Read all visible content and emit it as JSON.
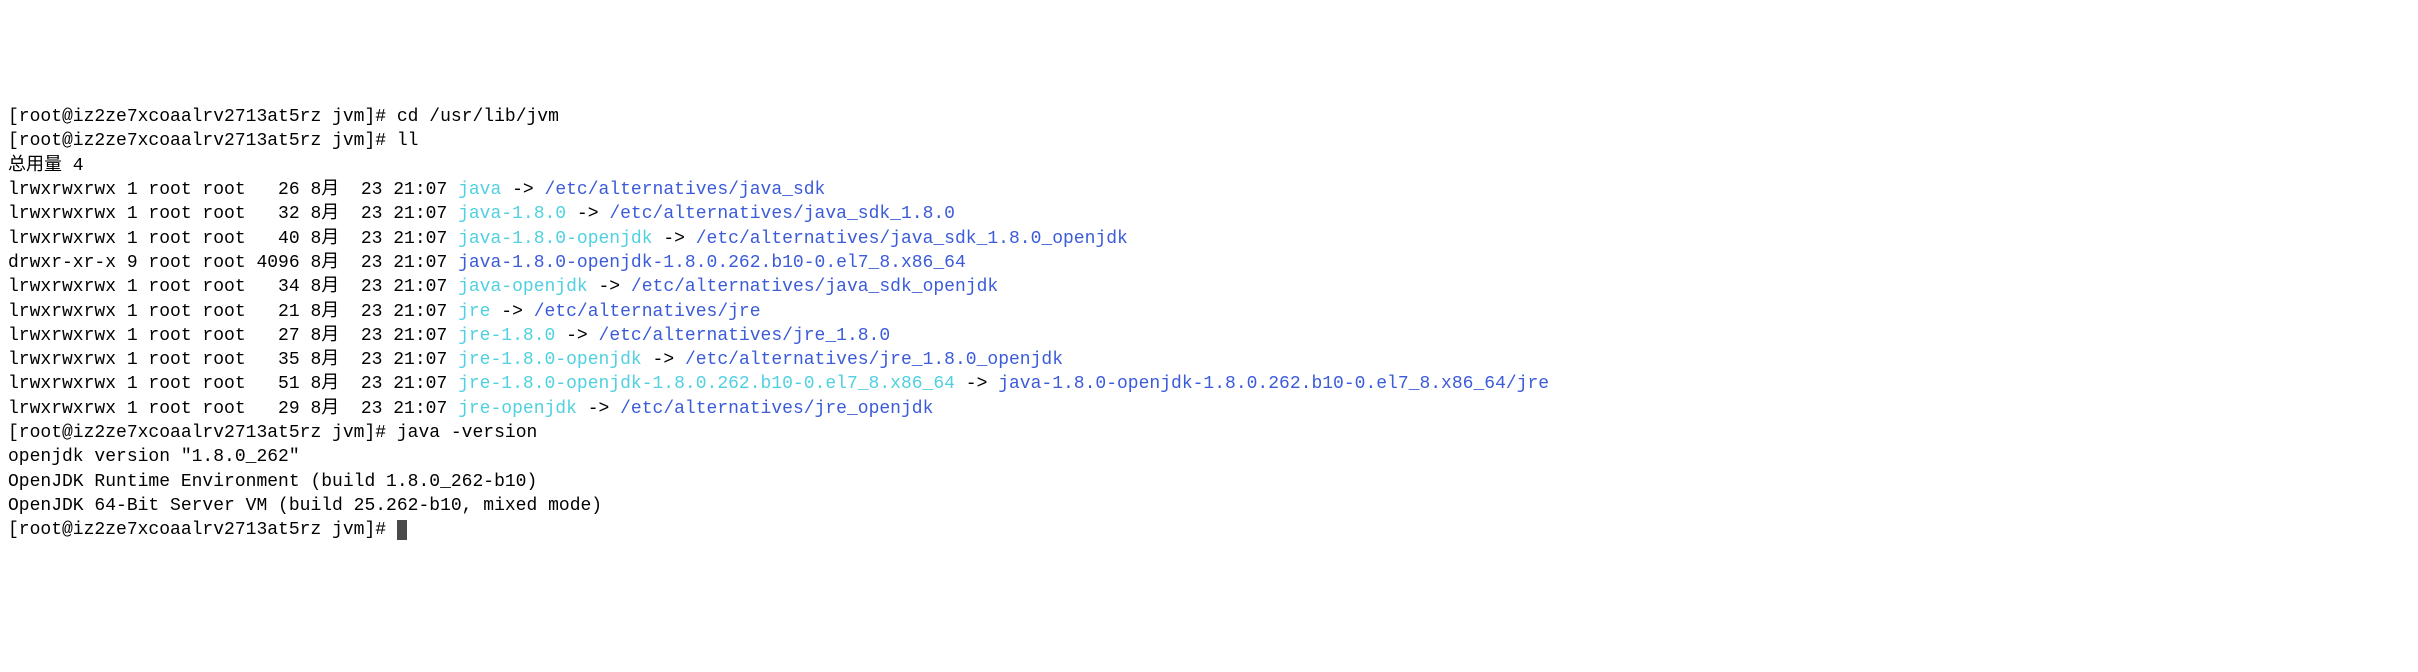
{
  "prompt": "[root@iz2ze7xcoaalrv2713at5rz jvm]# ",
  "cmd_cd": "cd /usr/lib/jvm",
  "cmd_ll": "ll",
  "cmd_java_version": "java -version",
  "total_line": "总用量 4",
  "listings": [
    {
      "perms": "lrwxrwxrwx 1 root root   26 8月  23 21:07 ",
      "name": "java",
      "arrow": " -> ",
      "target": "/etc/alternatives/java_sdk"
    },
    {
      "perms": "lrwxrwxrwx 1 root root   32 8月  23 21:07 ",
      "name": "java-1.8.0",
      "arrow": " -> ",
      "target": "/etc/alternatives/java_sdk_1.8.0"
    },
    {
      "perms": "lrwxrwxrwx 1 root root   40 8月  23 21:07 ",
      "name": "java-1.8.0-openjdk",
      "arrow": " -> ",
      "target": "/etc/alternatives/java_sdk_1.8.0_openjdk"
    },
    {
      "perms": "drwxr-xr-x 9 root root 4096 8月  23 21:07 ",
      "name": "java-1.8.0-openjdk-1.8.0.262.b10-0.el7_8.x86_64",
      "arrow": "",
      "target": "",
      "name_color": "blue"
    },
    {
      "perms": "lrwxrwxrwx 1 root root   34 8月  23 21:07 ",
      "name": "java-openjdk",
      "arrow": " -> ",
      "target": "/etc/alternatives/java_sdk_openjdk"
    },
    {
      "perms": "lrwxrwxrwx 1 root root   21 8月  23 21:07 ",
      "name": "jre",
      "arrow": " -> ",
      "target": "/etc/alternatives/jre"
    },
    {
      "perms": "lrwxrwxrwx 1 root root   27 8月  23 21:07 ",
      "name": "jre-1.8.0",
      "arrow": " -> ",
      "target": "/etc/alternatives/jre_1.8.0"
    },
    {
      "perms": "lrwxrwxrwx 1 root root   35 8月  23 21:07 ",
      "name": "jre-1.8.0-openjdk",
      "arrow": " -> ",
      "target": "/etc/alternatives/jre_1.8.0_openjdk"
    },
    {
      "perms": "lrwxrwxrwx 1 root root   51 8月  23 21:07 ",
      "name": "jre-1.8.0-openjdk-1.8.0.262.b10-0.el7_8.x86_64",
      "arrow": " -> ",
      "target": "java-1.8.0-openjdk-1.8.0.262.b10-0.el7_8.x86_64/jre"
    },
    {
      "perms": "lrwxrwxrwx 1 root root   29 8月  23 21:07 ",
      "name": "jre-openjdk",
      "arrow": " -> ",
      "target": "/etc/alternatives/jre_openjdk"
    }
  ],
  "version_output": [
    "openjdk version \"1.8.0_262\"",
    "OpenJDK Runtime Environment (build 1.8.0_262-b10)",
    "OpenJDK 64-Bit Server VM (build 25.262-b10, mixed mode)"
  ]
}
